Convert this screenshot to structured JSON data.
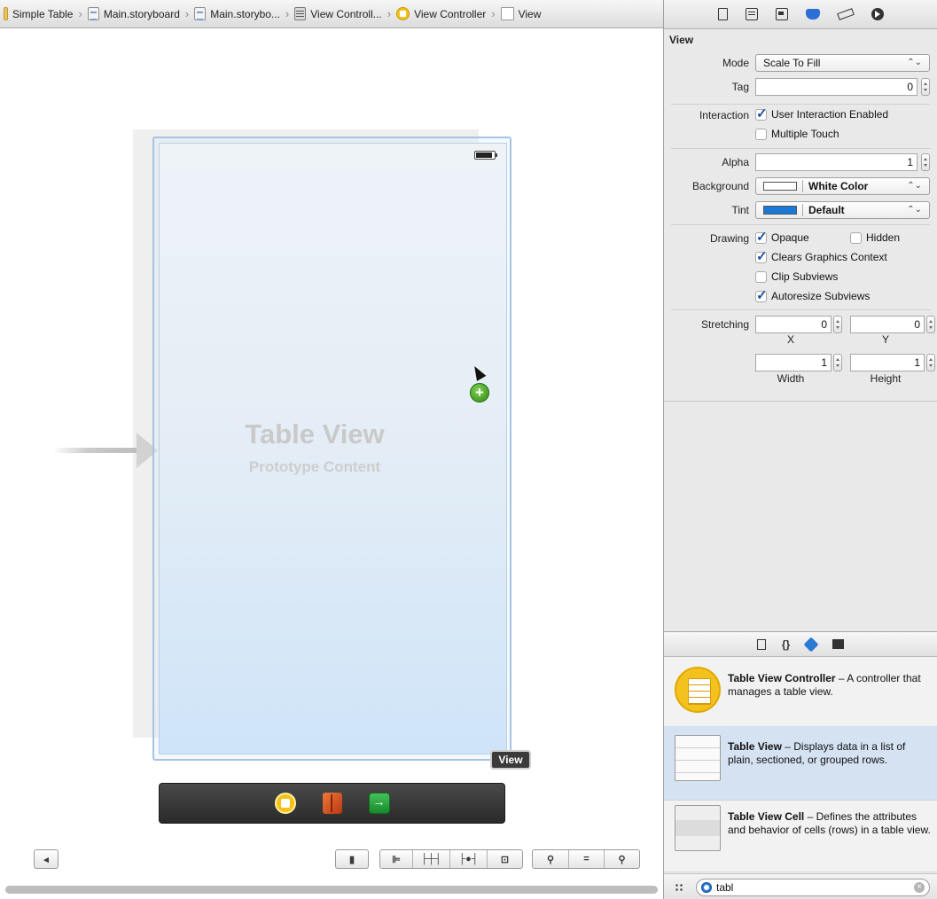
{
  "jumpbar": {
    "items": [
      {
        "label": "Simple Table",
        "icon": "folder-icon"
      },
      {
        "label": "Main.storyboard",
        "icon": "storyboard-icon"
      },
      {
        "label": "Main.storybo...",
        "icon": "storyboard-icon"
      },
      {
        "label": "View Controll...",
        "icon": "scene-icon"
      },
      {
        "label": "View Controller",
        "icon": "view-controller-icon"
      },
      {
        "label": "View",
        "icon": "view-icon"
      }
    ]
  },
  "canvas": {
    "table_view_title": "Table View",
    "table_view_subtitle": "Prototype Content",
    "tooltip": "View",
    "dock_icons": [
      "view-controller-icon",
      "first-responder-icon",
      "exit-icon"
    ]
  },
  "inspector": {
    "tabs": [
      "file-inspector-icon",
      "quick-help-icon",
      "identity-inspector-icon",
      "attributes-inspector-icon",
      "size-inspector-icon",
      "connections-inspector-icon"
    ],
    "section": "View",
    "mode": {
      "label": "Mode",
      "value": "Scale To Fill"
    },
    "tag": {
      "label": "Tag",
      "value": "0"
    },
    "interaction": {
      "label": "Interaction",
      "user_interaction": {
        "label": "User Interaction Enabled",
        "checked": true
      },
      "multiple_touch": {
        "label": "Multiple Touch",
        "checked": false
      }
    },
    "alpha": {
      "label": "Alpha",
      "value": "1"
    },
    "background": {
      "label": "Background",
      "value": "White Color",
      "swatch": "#ffffff"
    },
    "tint": {
      "label": "Tint",
      "value": "Default",
      "swatch": "#1a78d6"
    },
    "drawing": {
      "label": "Drawing",
      "opaque": {
        "label": "Opaque",
        "checked": true
      },
      "hidden": {
        "label": "Hidden",
        "checked": false
      },
      "clears": {
        "label": "Clears Graphics Context",
        "checked": true
      },
      "clip": {
        "label": "Clip Subviews",
        "checked": false
      },
      "autoresize": {
        "label": "Autoresize Subviews",
        "checked": true
      }
    },
    "stretching": {
      "label": "Stretching",
      "x": {
        "value": "0",
        "label": "X"
      },
      "y": {
        "value": "0",
        "label": "Y"
      },
      "width": {
        "value": "1",
        "label": "Width"
      },
      "height": {
        "value": "1",
        "label": "Height"
      }
    }
  },
  "library": {
    "tabs": [
      "file-template-icon",
      "code-snippet-icon",
      "object-library-icon",
      "media-library-icon"
    ],
    "code_snippet_label": "{}",
    "items": [
      {
        "title": "Table View Controller",
        "desc": " – A controller that manages a table view."
      },
      {
        "title": "Table View",
        "desc": " – Displays data in a list of plain, sectioned, or grouped rows."
      },
      {
        "title": "Table View Cell",
        "desc": " – Defines the attributes and behavior of cells (rows) in a table view."
      }
    ],
    "search": {
      "value": "tabl"
    }
  }
}
